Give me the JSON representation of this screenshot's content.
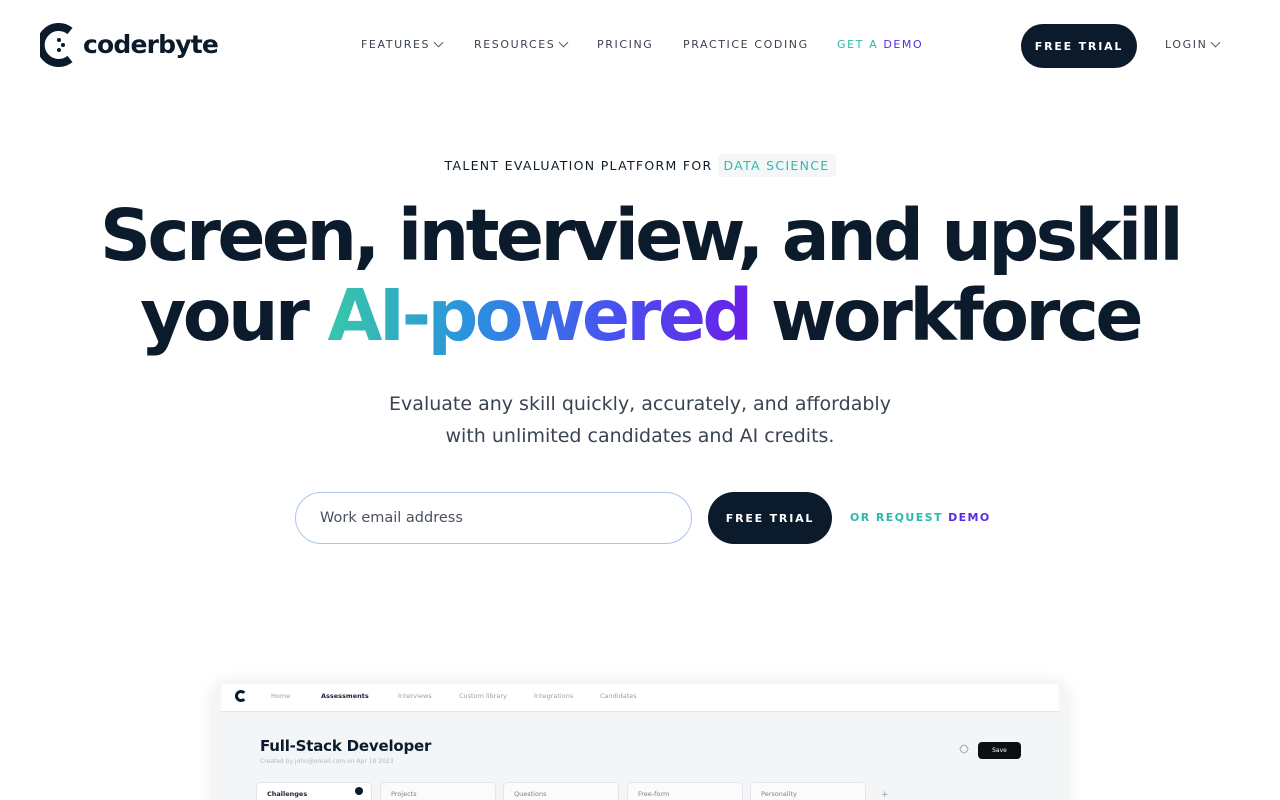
{
  "header": {
    "logo_text": "coderbyte",
    "nav": [
      {
        "label": "FEATURES"
      },
      {
        "label": "RESOURCES"
      },
      {
        "label": "PRICING"
      },
      {
        "label": "PRACTICE CODING"
      }
    ],
    "demo_link": {
      "part1": "GET A ",
      "part2": "DEMO"
    },
    "free_trial_label": "FREE TRIAL",
    "login_label": "LOGIN"
  },
  "hero": {
    "eyebrow": "TALENT EVALUATION PLATFORM FOR",
    "eyebrow_highlight": "DATA SCIENCE",
    "headline_line1": "Screen, interview, and upskill",
    "headline_line2_pre": "your ",
    "headline_line2_highlight": "AI-powered",
    "headline_line2_post": " workforce",
    "subtitle_line1": "Evaluate any skill quickly, accurately, and affordably",
    "subtitle_line2": "with unlimited candidates and AI credits.",
    "email_placeholder": "Work email address",
    "cta_label": "FREE TRIAL",
    "request_demo": {
      "part1": "OR REQUEST ",
      "part2": "DEMO"
    }
  },
  "preview": {
    "nav": [
      "Home",
      "Assessments",
      "Interviews",
      "Custom library",
      "Integrations",
      "Candidates"
    ],
    "title": "Full-Stack Developer",
    "meta": "Created by john@email.com on Apr 18 2023",
    "save_label": "Save",
    "tabs": [
      "Challenges",
      "Projects",
      "Questions",
      "Free-form",
      "Personality"
    ],
    "plus": "+"
  },
  "colors": {
    "brand_dark": "#0b1b2b",
    "accent_teal": "#2bb9a9",
    "accent_purple": "#5a2be0",
    "input_border": "#a9c6ef"
  }
}
